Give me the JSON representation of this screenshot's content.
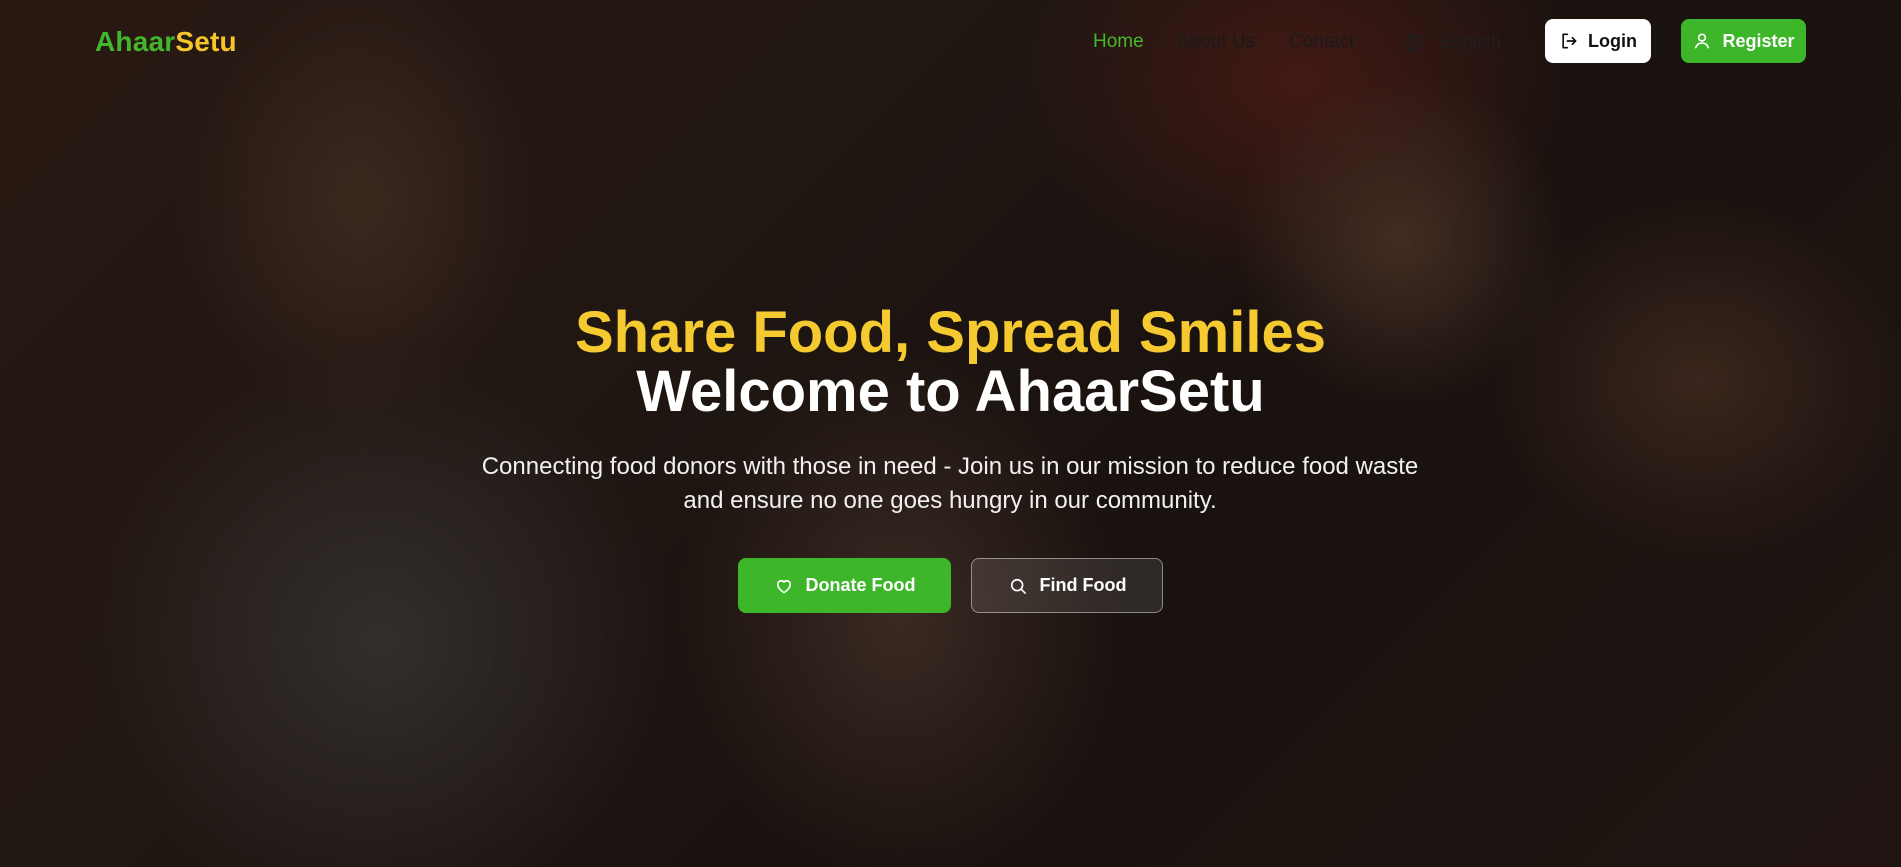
{
  "brand": {
    "part1": "Ahaar",
    "part2": "Setu"
  },
  "nav": {
    "links": [
      {
        "label": "Home",
        "active": true
      },
      {
        "label": "About Us",
        "active": false
      },
      {
        "label": "Contact",
        "active": false
      }
    ],
    "language": {
      "label": "English",
      "icon": "globe-icon"
    },
    "login": {
      "label": "Login",
      "icon": "login-icon"
    },
    "register": {
      "label": "Register",
      "icon": "user-icon"
    }
  },
  "hero": {
    "headline": "Share Food, Spread Smiles",
    "welcome": "Welcome to AhaarSetu",
    "subtitle": "Connecting food donors with those in need - Join us in our mission to reduce food waste and ensure no one goes hungry in our community.",
    "donate_button": {
      "label": "Donate Food",
      "icon": "heart-icon"
    },
    "find_button": {
      "label": "Find Food",
      "icon": "search-icon"
    }
  },
  "colors": {
    "brand_green": "#3db62a",
    "brand_yellow": "#f5c930"
  }
}
